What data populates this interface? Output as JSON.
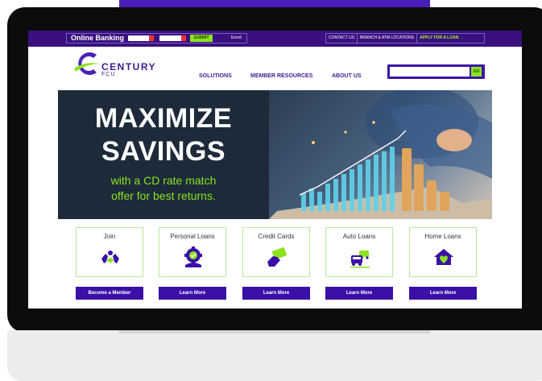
{
  "utility_bar": {
    "online_banking_label": "Online Banking",
    "submit_label": "SUBMIT",
    "enroll_label": "Enroll",
    "links": [
      "CONTACT US",
      "BRANCH & ATM LOCATIONS",
      "APPLY FOR A LOAN →"
    ]
  },
  "brand": {
    "name": "CENTURY",
    "sub": "FCU"
  },
  "nav": [
    "SOLUTIONS",
    "MEMBER RESOURCES",
    "ABOUT US"
  ],
  "search": {
    "go_label": "GO"
  },
  "hero": {
    "line1": "MAXIMIZE",
    "line2": "SAVINGS",
    "sub1": "with a CD rate match",
    "sub2": "offer for best returns."
  },
  "cards": [
    {
      "title": "Join",
      "button": "Become a Member",
      "icon": "member-hands-icon"
    },
    {
      "title": "Personal Loans",
      "button": "Learn More",
      "icon": "gear-check-icon"
    },
    {
      "title": "Credit Cards",
      "button": "Learn More",
      "icon": "credit-card-icon"
    },
    {
      "title": "Auto Loans",
      "button": "Learn More",
      "icon": "cars-icon"
    },
    {
      "title": "Home Loans",
      "button": "Learn More",
      "icon": "home-heart-icon"
    }
  ],
  "colors": {
    "brand_purple": "#3a10a8",
    "accent_green": "#8be31f",
    "hero_dark": "#1d2a3a"
  }
}
